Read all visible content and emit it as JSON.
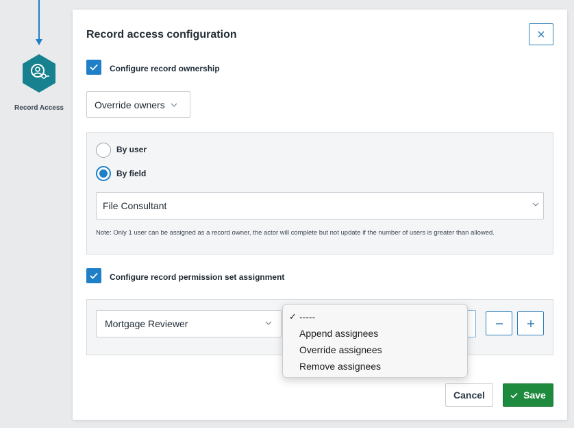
{
  "canvas": {
    "node_label": "Record Access",
    "node_icon": "record-access-icon",
    "flow_color": "#1f7fc7"
  },
  "modal": {
    "title": "Record access configuration",
    "close_icon": "close-icon"
  },
  "ownership": {
    "checkbox_label": "Configure record ownership",
    "checked": true,
    "mode_select": {
      "value": "Override owners"
    },
    "radios": [
      {
        "label": "By user",
        "selected": false
      },
      {
        "label": "By field",
        "selected": true
      }
    ],
    "field_select": {
      "value": "File Consultant"
    },
    "note": "Note: Only 1 user can be assigned as a record owner, the actor will complete but not update if the number of users is greater than allowed."
  },
  "permissions": {
    "checkbox_label": "Configure record permission set assignment",
    "checked": true,
    "permission_select": {
      "value": "Mortgage Reviewer"
    },
    "mode_options": [
      {
        "label": "-----",
        "selected": true
      },
      {
        "label": "Append assignees",
        "selected": false
      },
      {
        "label": "Override assignees",
        "selected": false
      },
      {
        "label": "Remove assignees",
        "selected": false
      }
    ],
    "remove_icon": "minus-icon",
    "add_icon": "plus-icon"
  },
  "footer": {
    "cancel_label": "Cancel",
    "save_label": "Save"
  },
  "colors": {
    "accent": "#1f7fc7",
    "save": "#1e8a3e",
    "node": "#17818f"
  }
}
